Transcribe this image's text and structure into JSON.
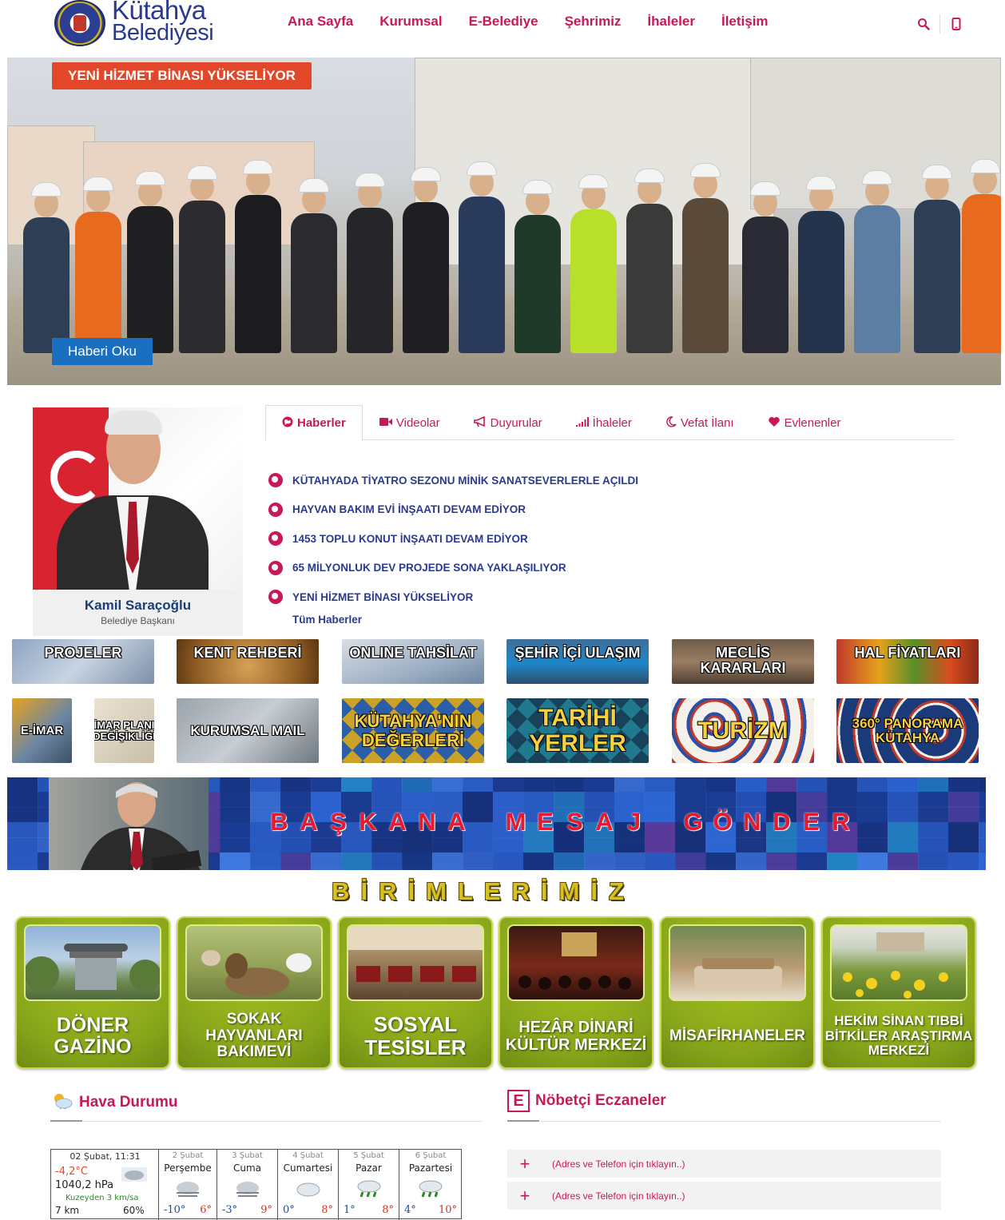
{
  "header": {
    "logo": {
      "line1": "Kütahya",
      "line2": "Belediyesi"
    },
    "nav": [
      "Ana Sayfa",
      "Kurumsal",
      "E-Belediye",
      "Şehrimiz",
      "İhaleler",
      "İletişim"
    ],
    "icons": [
      "search-icon",
      "mobile-icon"
    ]
  },
  "hero": {
    "badge": "YENİ HİZMET BİNASI YÜKSELİYOR",
    "button": "Haberi Oku"
  },
  "mayor": {
    "name": "Kamil Saraçoğlu",
    "role": "Belediye Başkanı"
  },
  "tabs": [
    {
      "label": "Haberler",
      "icon": "globe-icon",
      "active": true
    },
    {
      "label": "Videolar",
      "icon": "video-icon",
      "active": false
    },
    {
      "label": "Duyurular",
      "icon": "bullhorn-icon",
      "active": false
    },
    {
      "label": "İhaleler",
      "icon": "signal-icon",
      "active": false
    },
    {
      "label": "Vefat İlanı",
      "icon": "moon-icon",
      "active": false
    },
    {
      "label": "Evlenenler",
      "icon": "heart-icon",
      "active": false
    }
  ],
  "news": [
    "KÜTAHYADA TİYATRO SEZONU MİNİK SANATSEVERLERLE AÇILDI",
    "HAYVAN BAKIM EVİ İNŞAATI DEVAM EDİYOR",
    "1453 TOPLU KONUT İNŞAATI DEVAM EDİYOR",
    "65 MİLYONLUK DEV PROJEDE SONA YAKLAŞILIYOR",
    "YENİ HİZMET BİNASI YÜKSELİYOR"
  ],
  "news_all": "Tüm Haberler",
  "tiles_row1": [
    "PROJELER",
    "KENT REHBERİ",
    "ONLINE TAHSİLAT",
    "ŞEHİR İÇİ ULAŞIM",
    "MECLİS KARARLARI",
    "HAL FİYATLARI"
  ],
  "tiles_row2": [
    "E-İMAR",
    "İMAR PLANI DEĞİŞİKLİĞİ",
    "KURUMSAL MAIL",
    "KÜTAHYA'NIN DEĞERLERİ",
    "TARİHİ YERLER",
    "TURİZM",
    "360° PANORAMA KÜTAHYA"
  ],
  "banner": {
    "letters": [
      "B",
      "A",
      "Ş",
      "K",
      "A",
      "N",
      "A",
      " ",
      "M",
      "E",
      "S",
      "A",
      "J",
      " ",
      "G",
      "Ö",
      "N",
      "D",
      "E",
      "R"
    ]
  },
  "birim_title": "BİRİMLERİMİZ",
  "birimler": [
    {
      "label": "DÖNER GAZİNO"
    },
    {
      "label": "SOKAK HAYVANLARI BAKIMEVİ"
    },
    {
      "label": "SOSYAL TESİSLER"
    },
    {
      "label": "HEZÂR DİNARİ KÜLTÜR MERKEZİ"
    },
    {
      "label": "MİSAFİRHANELER"
    },
    {
      "label": "HEKİM SİNAN TIBBİ BİTKİLER ARAŞTIRMA MERKEZİ"
    }
  ],
  "weather": {
    "title": "Hava Durumu",
    "current": {
      "date": "02 Şubat, 11:31",
      "temp": "-4,2°C",
      "pressure": "1040,2 hPa",
      "wind": "Kuzeyden 3 km/sa",
      "visibility": "7 km",
      "humidity": "60%"
    },
    "days": [
      {
        "date": "2 Şubat",
        "name": "Perşembe",
        "icon": "fog-icon",
        "lo": "-10°",
        "hi": "6°"
      },
      {
        "date": "3 Şubat",
        "name": "Cuma",
        "icon": "fog-icon",
        "lo": "-3°",
        "hi": "9°"
      },
      {
        "date": "4 Şubat",
        "name": "Cumartesi",
        "icon": "cloud-icon",
        "lo": "0°",
        "hi": "8°"
      },
      {
        "date": "5 Şubat",
        "name": "Pazar",
        "icon": "rain-icon",
        "lo": "1°",
        "hi": "8°"
      },
      {
        "date": "6 Şubat",
        "name": "Pazartesi",
        "icon": "rain-icon",
        "lo": "4°",
        "hi": "10°"
      }
    ]
  },
  "pharmacy": {
    "title": "Nöbetçi Eczaneler",
    "badge": "E",
    "rows": [
      "(Adres ve Telefon için tıklayın..)",
      "(Adres ve Telefon için tıklayın..)"
    ]
  },
  "colors": {
    "accent": "#c8185a",
    "navy": "#2a3a8f",
    "hero_badge": "#e2472a",
    "hero_button": "#1a6fc1"
  }
}
